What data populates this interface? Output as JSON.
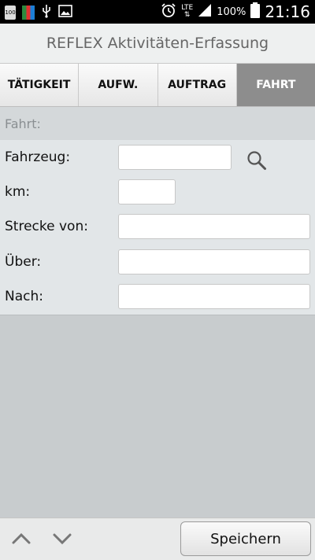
{
  "status_bar": {
    "battery_small_label": "100",
    "lte_label": "LTE",
    "battery_percent": "100%",
    "time": "21:16"
  },
  "app": {
    "title": "REFLEX Aktivitäten-Erfassung"
  },
  "tabs": [
    {
      "label": "TÄTIGKEIT"
    },
    {
      "label": "AUFW."
    },
    {
      "label": "AUFTRAG"
    },
    {
      "label": "FAHRT"
    }
  ],
  "active_tab": "FAHRT",
  "section": {
    "title": "Fahrt:"
  },
  "form": {
    "vehicle_label": "Fahrzeug:",
    "km_label": "km:",
    "route_from_label": "Strecke von:",
    "via_label": "Über:",
    "to_label": "Nach:"
  },
  "footer": {
    "save_label": "Speichern"
  },
  "colors": {
    "active_tab_bg": "#8d8d8d",
    "page_bg": "#c8ccce",
    "form_bg": "#e2e6e8"
  }
}
